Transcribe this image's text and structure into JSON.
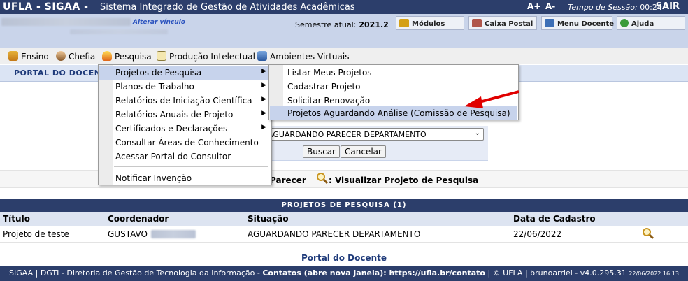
{
  "topbar": {
    "brand": "UFLA - SIGAA -",
    "system_name": "Sistema Integrado de Gestão de Atividades Acadêmicas",
    "font_increase": "A+",
    "font_decrease": "A-",
    "session_label": "Tempo de Sessão:",
    "session_time": "00:24",
    "logout": "SAIR"
  },
  "infobar": {
    "alterar_vinculo": "Alterar vínculo",
    "semestre_label": "Semestre atual:",
    "semestre_value": "2021.2",
    "buttons": [
      {
        "label": "Módulos",
        "icon": "modules-icon"
      },
      {
        "label": "Caixa Postal",
        "icon": "mailbox-icon"
      },
      {
        "label": "Menu Docente",
        "icon": "menu-icon"
      },
      {
        "label": "Ajuda",
        "icon": "help-icon"
      }
    ]
  },
  "menubar": {
    "items": [
      {
        "label": "Ensino",
        "icon": "books-icon"
      },
      {
        "label": "Chefia",
        "icon": "person-icon"
      },
      {
        "label": "Pesquisa",
        "icon": "flask-icon"
      },
      {
        "label": "Produção Intelectual",
        "icon": "document-icon"
      },
      {
        "label": "Ambientes Virtuais",
        "icon": "network-icon"
      }
    ]
  },
  "portal_bar": {
    "title": "PORTAL DO DOCENTE"
  },
  "pesquisa_menu": {
    "items": [
      "Projetos de Pesquisa",
      "Planos de Trabalho",
      "Relatórios de Iniciação Científica",
      "Relatórios Anuais de Projeto",
      "Certificados e Declarações",
      "Consultar Áreas de Conhecimento",
      "Acessar Portal do Consultor",
      "Notificar Invenção"
    ]
  },
  "projetos_submenu": {
    "items": [
      "Listar Meus Projetos",
      "Cadastrar Projeto",
      "Solicitar Renovação",
      "Projetos Aguardando Análise (Comissão de Pesquisa)"
    ]
  },
  "form": {
    "situacao_selected": "AGUARDANDO PARECER DEPARTAMENTO",
    "buscar": "Buscar",
    "cancelar": "Cancelar"
  },
  "legend": {
    "parecer": "Parecer",
    "visualizar": ": Visualizar Projeto de Pesquisa"
  },
  "table": {
    "caption": "PROJETOS DE PESQUISA (1)",
    "headers": [
      "Título",
      "Coordenador",
      "Situação",
      "Data de Cadastro"
    ],
    "rows": [
      {
        "titulo": "Projeto de teste",
        "coordenador": "GUSTAVO",
        "situacao": "AGUARDANDO PARECER DEPARTAMENTO",
        "data": "22/06/2022"
      }
    ]
  },
  "portal_link": "Portal do Docente",
  "footer": {
    "text": "SIGAA | DGTI - Diretoria de Gestão de Tecnologia da Informação -",
    "contatos": "Contatos (abre nova janela): https://ufla.br/contato",
    "rest": "| © UFLA | brunoarriel - v4.0.295.31",
    "datetime": "22/06/2022 16:13"
  },
  "colors": {
    "header_blue": "#2c3e6b",
    "info_blue": "#c9d4ea",
    "highlight": "#c7d3ec",
    "arrow_red": "#e00000"
  }
}
